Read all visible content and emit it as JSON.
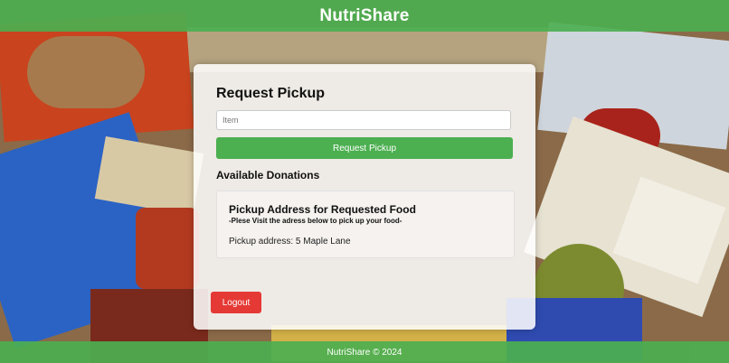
{
  "header": {
    "brand": "NutriShare"
  },
  "request_form": {
    "title": "Request Pickup",
    "item_input": {
      "placeholder": "Item",
      "value": ""
    },
    "submit_label": "Request Pickup"
  },
  "donations": {
    "title": "Available Donations",
    "items": [
      {
        "heading": "Pickup Address for Requested Food",
        "subheading": "-Plese Visit the adress below to pick up your food-",
        "address": "Pickup address: 5 Maple Lane"
      }
    ]
  },
  "actions": {
    "logout_label": "Logout"
  },
  "footer": {
    "text": "NutriShare © 2024"
  },
  "colors": {
    "accent": "#4caf50",
    "danger": "#e53935"
  }
}
